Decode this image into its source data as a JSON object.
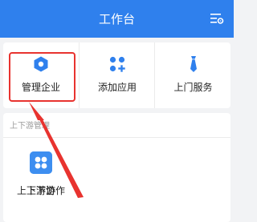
{
  "header": {
    "title": "工作台",
    "settings_icon": "list-settings-icon"
  },
  "tools": [
    {
      "label": "管理企业",
      "icon": "hexagon-icon",
      "highlighted": true
    },
    {
      "label": "添加应用",
      "icon": "grid-plus-icon"
    },
    {
      "label": "上门服务",
      "icon": "tie-icon"
    }
  ],
  "partners": {
    "section_title": "上下游管理",
    "items": [
      {
        "label": "上下游",
        "icon": "link-icon"
      },
      {
        "label": "上下游协作",
        "icon": "four-dots-icon"
      }
    ]
  },
  "colors": {
    "accent": "#2f80ed",
    "highlight": "#e8332f"
  }
}
